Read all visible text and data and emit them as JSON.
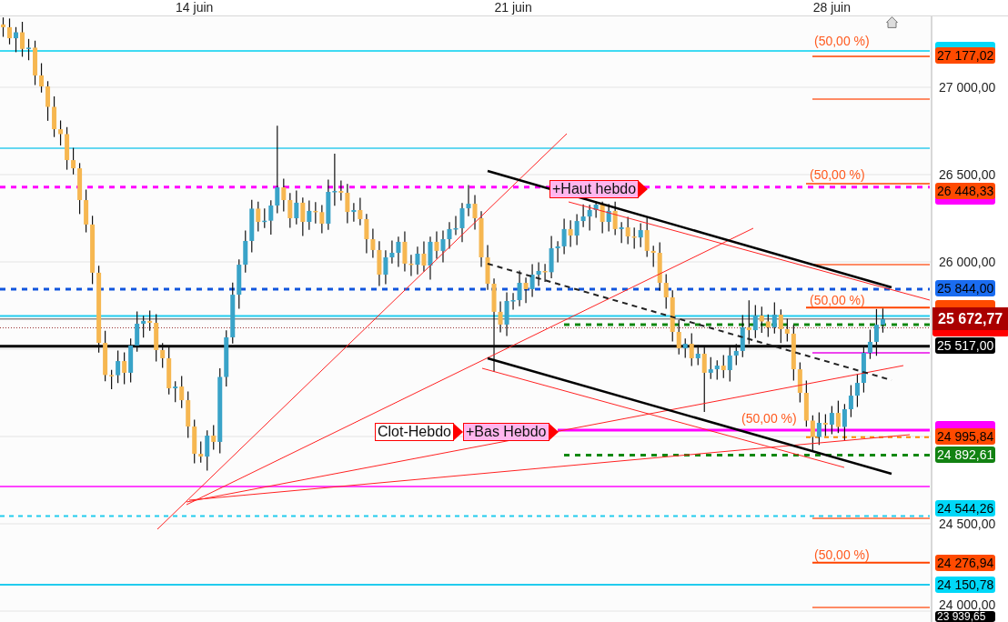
{
  "chart": {
    "chart_data": {
      "type": "candlestick",
      "ylim": [
        23937.5,
        27406.25
      ],
      "grid": true,
      "yticks": [
        {
          "value": 27000,
          "label": "27 000,00"
        },
        {
          "value": 26500,
          "label": "26 500,00"
        },
        {
          "value": 26000,
          "label": "26 000,00"
        },
        {
          "value": 24500,
          "label": "24 500,00"
        },
        {
          "value": 24000,
          "label": "24 000,00"
        }
      ],
      "categories": [
        null,
        null,
        null,
        null,
        null,
        null,
        null,
        null,
        null,
        null,
        null,
        null,
        null,
        null,
        null,
        null,
        null,
        null,
        null,
        null,
        null,
        null,
        null,
        null,
        null,
        null,
        null,
        null,
        null,
        null,
        "14 juin",
        null,
        null,
        null,
        null,
        null,
        null,
        null,
        null,
        null,
        null,
        null,
        null,
        null,
        null,
        null,
        null,
        null,
        null,
        null,
        null,
        null,
        null,
        null,
        null,
        null,
        null,
        null,
        null,
        null,
        null,
        null,
        null,
        null,
        null,
        null,
        null,
        null,
        null,
        null,
        null,
        null,
        null,
        null,
        null,
        null,
        null,
        null,
        null,
        null,
        "21 juin",
        null,
        null,
        null,
        null,
        null,
        null,
        null,
        null,
        null,
        null,
        null,
        null,
        null,
        null,
        null,
        null,
        null,
        null,
        null,
        null,
        null,
        null,
        null,
        null,
        null,
        null,
        null,
        null,
        null,
        null,
        null,
        null,
        null,
        null,
        null,
        null,
        null,
        null,
        null,
        null,
        null,
        null,
        null,
        null,
        null,
        null,
        null,
        null,
        null,
        "28 juin",
        null,
        null,
        null,
        null,
        null,
        null,
        null,
        null
      ],
      "ohlc": [
        [
          27360,
          27400,
          27289,
          27344
        ],
        [
          27344,
          27394,
          27246,
          27281
        ],
        [
          27281,
          27345,
          27201,
          27315
        ],
        [
          27315,
          27375,
          27175,
          27220
        ],
        [
          27220,
          27277,
          27155,
          27227
        ],
        [
          27227,
          27267,
          27013,
          27068
        ],
        [
          27068,
          27138,
          26970,
          27005
        ],
        [
          27005,
          27035,
          26808,
          26888
        ],
        [
          26888,
          26948,
          26715,
          26760
        ],
        [
          26760,
          26810,
          26667,
          26732
        ],
        [
          26732,
          26772,
          26528,
          26583
        ],
        [
          26583,
          26653,
          26501,
          26536
        ],
        [
          26536,
          26566,
          26274,
          26354
        ],
        [
          26354,
          26414,
          26169,
          26214
        ],
        [
          26214,
          26264,
          25873,
          25938
        ],
        [
          25938,
          25978,
          25481,
          25536
        ],
        [
          25536,
          25606,
          25317,
          25352
        ],
        [
          25352,
          25382,
          25271,
          25351
        ],
        [
          25351,
          25492,
          25306,
          25432
        ],
        [
          25432,
          25482,
          25300,
          25365
        ],
        [
          25365,
          25561,
          25310,
          25521
        ],
        [
          25521,
          25716,
          25486,
          25646
        ],
        [
          25646,
          25692,
          25566,
          25662
        ],
        [
          25662,
          25722,
          25606,
          25651
        ],
        [
          25651,
          25701,
          25430,
          25495
        ],
        [
          25495,
          25535,
          25393,
          25448
        ],
        [
          25448,
          25518,
          25241,
          25276
        ],
        [
          25276,
          25316,
          25196,
          25286
        ],
        [
          25286,
          25346,
          25163,
          25208
        ],
        [
          25208,
          25258,
          24992,
          25057
        ],
        [
          25057,
          25097,
          24846,
          24901
        ],
        [
          24901,
          24971,
          24850,
          24885
        ],
        [
          24885,
          25035,
          24805,
          25005
        ],
        [
          25005,
          25065,
          24924,
          24969
        ],
        [
          24969,
          25391,
          24904,
          25341
        ],
        [
          25341,
          25608,
          25286,
          25568
        ],
        [
          25568,
          25882,
          25533,
          25812
        ],
        [
          25812,
          26014,
          25732,
          25984
        ],
        [
          25984,
          26180,
          25939,
          26120
        ],
        [
          26120,
          26355,
          26055,
          26305
        ],
        [
          26305,
          26345,
          26174,
          26229
        ],
        [
          26229,
          26306,
          26194,
          26236
        ],
        [
          26236,
          26353,
          26156,
          26323
        ],
        [
          26323,
          26780,
          26278,
          26427
        ],
        [
          26427,
          26477,
          26289,
          26354
        ],
        [
          26354,
          26394,
          26195,
          26250
        ],
        [
          26250,
          26409,
          26215,
          26339
        ],
        [
          26339,
          26369,
          26149,
          26229
        ],
        [
          26229,
          26352,
          26184,
          26292
        ],
        [
          26292,
          26342,
          26220,
          26285
        ],
        [
          26285,
          26325,
          26164,
          26219
        ],
        [
          26219,
          26471,
          26184,
          26401
        ],
        [
          26401,
          26620,
          26321,
          26406
        ],
        [
          26406,
          26466,
          26351,
          26396
        ],
        [
          26396,
          26446,
          26221,
          26286
        ],
        [
          26286,
          26337,
          26231,
          26297
        ],
        [
          26297,
          26367,
          26210,
          26245
        ],
        [
          26245,
          26275,
          26050,
          26130
        ],
        [
          26130,
          26190,
          26023,
          26068
        ],
        [
          26068,
          26118,
          25862,
          25927
        ],
        [
          25927,
          26066,
          25872,
          26026
        ],
        [
          26026,
          26122,
          25991,
          26052
        ],
        [
          26052,
          26145,
          25972,
          26115
        ],
        [
          26115,
          26175,
          25945,
          25990
        ],
        [
          25990,
          26040,
          25919,
          25984
        ],
        [
          25984,
          26087,
          25929,
          26047
        ],
        [
          26047,
          26117,
          25944,
          25979
        ],
        [
          25979,
          26145,
          25899,
          26115
        ],
        [
          26115,
          26175,
          26018,
          26063
        ],
        [
          26063,
          26180,
          25998,
          26130
        ],
        [
          26130,
          26228,
          26075,
          26188
        ],
        [
          26188,
          26263,
          26153,
          26193
        ],
        [
          26193,
          26337,
          26113,
          26307
        ],
        [
          26307,
          26440,
          26262,
          26333
        ],
        [
          26333,
          26383,
          26185,
          26250
        ],
        [
          26250,
          26290,
          25971,
          26026
        ],
        [
          26026,
          26096,
          25840,
          25875
        ],
        [
          25875,
          25905,
          25370,
          25714
        ],
        [
          25714,
          25774,
          25596,
          25641
        ],
        [
          25641,
          25826,
          25576,
          25776
        ],
        [
          25776,
          25821,
          25726,
          25781
        ],
        [
          25781,
          25950,
          25746,
          25880
        ],
        [
          25880,
          25910,
          25764,
          25844
        ],
        [
          25844,
          25987,
          25799,
          25927
        ],
        [
          25927,
          25998,
          25862,
          25948
        ],
        [
          25948,
          25988,
          25886,
          25941
        ],
        [
          25941,
          26148,
          25906,
          26078
        ],
        [
          26078,
          26119,
          25998,
          26089
        ],
        [
          26089,
          26248,
          26044,
          26188
        ],
        [
          26188,
          26238,
          26086,
          26151
        ],
        [
          26151,
          26274,
          26096,
          26234
        ],
        [
          26234,
          26330,
          26199,
          26260
        ],
        [
          26260,
          26327,
          26180,
          26297
        ],
        [
          26297,
          26345,
          26252,
          26328
        ],
        [
          26328,
          26345,
          26164,
          26229
        ],
        [
          26229,
          26332,
          26174,
          26292
        ],
        [
          26292,
          26345,
          26153,
          26188
        ],
        [
          26188,
          26228,
          26108,
          26198
        ],
        [
          26198,
          26258,
          26101,
          26146
        ],
        [
          26146,
          26196,
          26075,
          26140
        ],
        [
          26140,
          26222,
          26085,
          26182
        ],
        [
          26182,
          26252,
          26028,
          26063
        ],
        [
          26063,
          26093,
          25972,
          26052
        ],
        [
          26052,
          26112,
          25835,
          25880
        ],
        [
          25880,
          25930,
          25732,
          25797
        ],
        [
          25797,
          25837,
          25544,
          25599
        ],
        [
          25599,
          25669,
          25470,
          25505
        ],
        [
          25505,
          25561,
          25451,
          25531
        ],
        [
          25531,
          25591,
          25403,
          25448
        ],
        [
          25448,
          25524,
          25409,
          25474
        ],
        [
          25474,
          25514,
          25140,
          25365
        ],
        [
          25365,
          25455,
          25330,
          25385
        ],
        [
          25385,
          25436,
          25326,
          25406
        ],
        [
          25406,
          25466,
          25335,
          25380
        ],
        [
          25380,
          25514,
          25315,
          25464
        ],
        [
          25464,
          25530,
          25409,
          25490
        ],
        [
          25490,
          25695,
          25455,
          25625
        ],
        [
          25625,
          25780,
          25529,
          25609
        ],
        [
          25609,
          25753,
          25564,
          25693
        ],
        [
          25693,
          25743,
          25594,
          25659
        ],
        [
          25659,
          25699,
          25570,
          25625
        ],
        [
          25625,
          25768,
          25590,
          25698
        ],
        [
          25698,
          25728,
          25535,
          25615
        ],
        [
          25615,
          25675,
          25544,
          25589
        ],
        [
          25589,
          25639,
          25320,
          25385
        ],
        [
          25385,
          25425,
          25195,
          25250
        ],
        [
          25250,
          25320,
          25056,
          25091
        ],
        [
          25091,
          25121,
          24917,
          24997
        ],
        [
          24997,
          25138,
          24952,
          25078
        ],
        [
          25078,
          25128,
          25003,
          25068
        ],
        [
          25068,
          25175,
          25013,
          25135
        ],
        [
          25135,
          25205,
          25020,
          25055
        ],
        [
          25055,
          25186,
          24975,
          25156
        ],
        [
          25156,
          25294,
          25111,
          25234
        ],
        [
          25234,
          25357,
          25169,
          25307
        ],
        [
          25307,
          25519,
          25252,
          25479
        ],
        [
          25479,
          25612,
          25444,
          25542
        ],
        [
          25542,
          25730,
          25462,
          25640
        ],
        [
          25640,
          25733,
          25595,
          25673
        ]
      ],
      "ref_lines": [
        {
          "axis": "y",
          "value": 27208,
          "color": "#00d0f0"
        },
        {
          "axis": "y",
          "value": 27177.02,
          "color": "#ff4400"
        },
        {
          "axis": "y",
          "value": 26932,
          "color": "#ff6633"
        },
        {
          "axis": "y",
          "value": 26651,
          "color": "#33ccee"
        },
        {
          "axis": "y",
          "value": 26448.33,
          "color": "#ff4400"
        },
        {
          "axis": "y",
          "value": 26428.24,
          "color": "#ff00ff"
        },
        {
          "axis": "y",
          "value": 25984,
          "color": "#ff6633"
        },
        {
          "axis": "y",
          "value": 25844,
          "color": "#1155dd"
        },
        {
          "axis": "y",
          "value": 25738.65,
          "color": "#ff4400"
        },
        {
          "axis": "y",
          "value": 25690,
          "color": "#22ccee"
        },
        {
          "axis": "y",
          "value": 25672.77,
          "color": "#555555"
        },
        {
          "axis": "y",
          "value": 25641,
          "color": "#118811"
        },
        {
          "axis": "y",
          "value": 25622.35,
          "color": "#993333"
        },
        {
          "axis": "y",
          "value": 25517,
          "color": "#000000"
        },
        {
          "axis": "y",
          "value": 25479,
          "color": "#ee44ee"
        },
        {
          "axis": "y",
          "value": 25036,
          "color": "#ff00ff"
        },
        {
          "axis": "y",
          "value": 24995.84,
          "color": "#ff8800"
        },
        {
          "axis": "y",
          "value": 24892.61,
          "color": "#118811"
        },
        {
          "axis": "y",
          "value": 24714,
          "color": "#ff44ff"
        },
        {
          "axis": "y",
          "value": 24544.26,
          "color": "#22ccee"
        },
        {
          "axis": "y",
          "value": 24531,
          "color": "#ff6633"
        },
        {
          "axis": "y",
          "value": 24276.94,
          "color": "#ff4400"
        },
        {
          "axis": "y",
          "value": 24150.78,
          "color": "#22ccee"
        },
        {
          "axis": "y",
          "value": 24021,
          "color": "#ff6633"
        }
      ]
    }
  },
  "price_tags": [
    {
      "kind": "covered",
      "color": "#00d8f8"
    },
    {
      "kind": "level",
      "value": "27 177,02",
      "color": "#ff4a00"
    },
    {
      "kind": "level",
      "value": "26 448,33",
      "color": "#ff4a00"
    },
    {
      "kind": "covered",
      "color": "#ff00ff"
    },
    {
      "kind": "level",
      "value": "25 844,00",
      "color": "#1a6cf0"
    },
    {
      "kind": "covered",
      "color": "#ff4a00"
    },
    {
      "kind": "covered",
      "color": "#ff0000"
    },
    {
      "kind": "current",
      "value": "25 672,77",
      "color": "#aa0000"
    },
    {
      "kind": "level",
      "value": "25 517,00",
      "color": "#000000"
    },
    {
      "kind": "covered",
      "color": "#ff00ff"
    },
    {
      "kind": "level",
      "value": "24 995,84",
      "color": "#ff4a00"
    },
    {
      "kind": "level",
      "value": "24 892,61",
      "color": "#128212"
    },
    {
      "kind": "level",
      "value": "24 544,26",
      "color": "#00d8f8"
    },
    {
      "kind": "level",
      "value": "24 276,94",
      "color": "#ff4a00"
    },
    {
      "kind": "level",
      "value": "24 150,78",
      "color": "#00d8f8"
    },
    {
      "kind": "level",
      "value": "23 939,65",
      "color": "#000000"
    }
  ],
  "fib_labels": [
    "(50,00 %)",
    "(50,00 %)",
    "(50,00 %)",
    "(50,00 %)",
    "(50,00 %)"
  ],
  "markers": [
    {
      "text": "+Haut hebdo",
      "color": "#ffb6ee"
    },
    {
      "text": "Clot-Hebdo",
      "color": "#ffffff"
    },
    {
      "text": "+Bas Hebdo",
      "color": "#ffb6ee"
    }
  ]
}
